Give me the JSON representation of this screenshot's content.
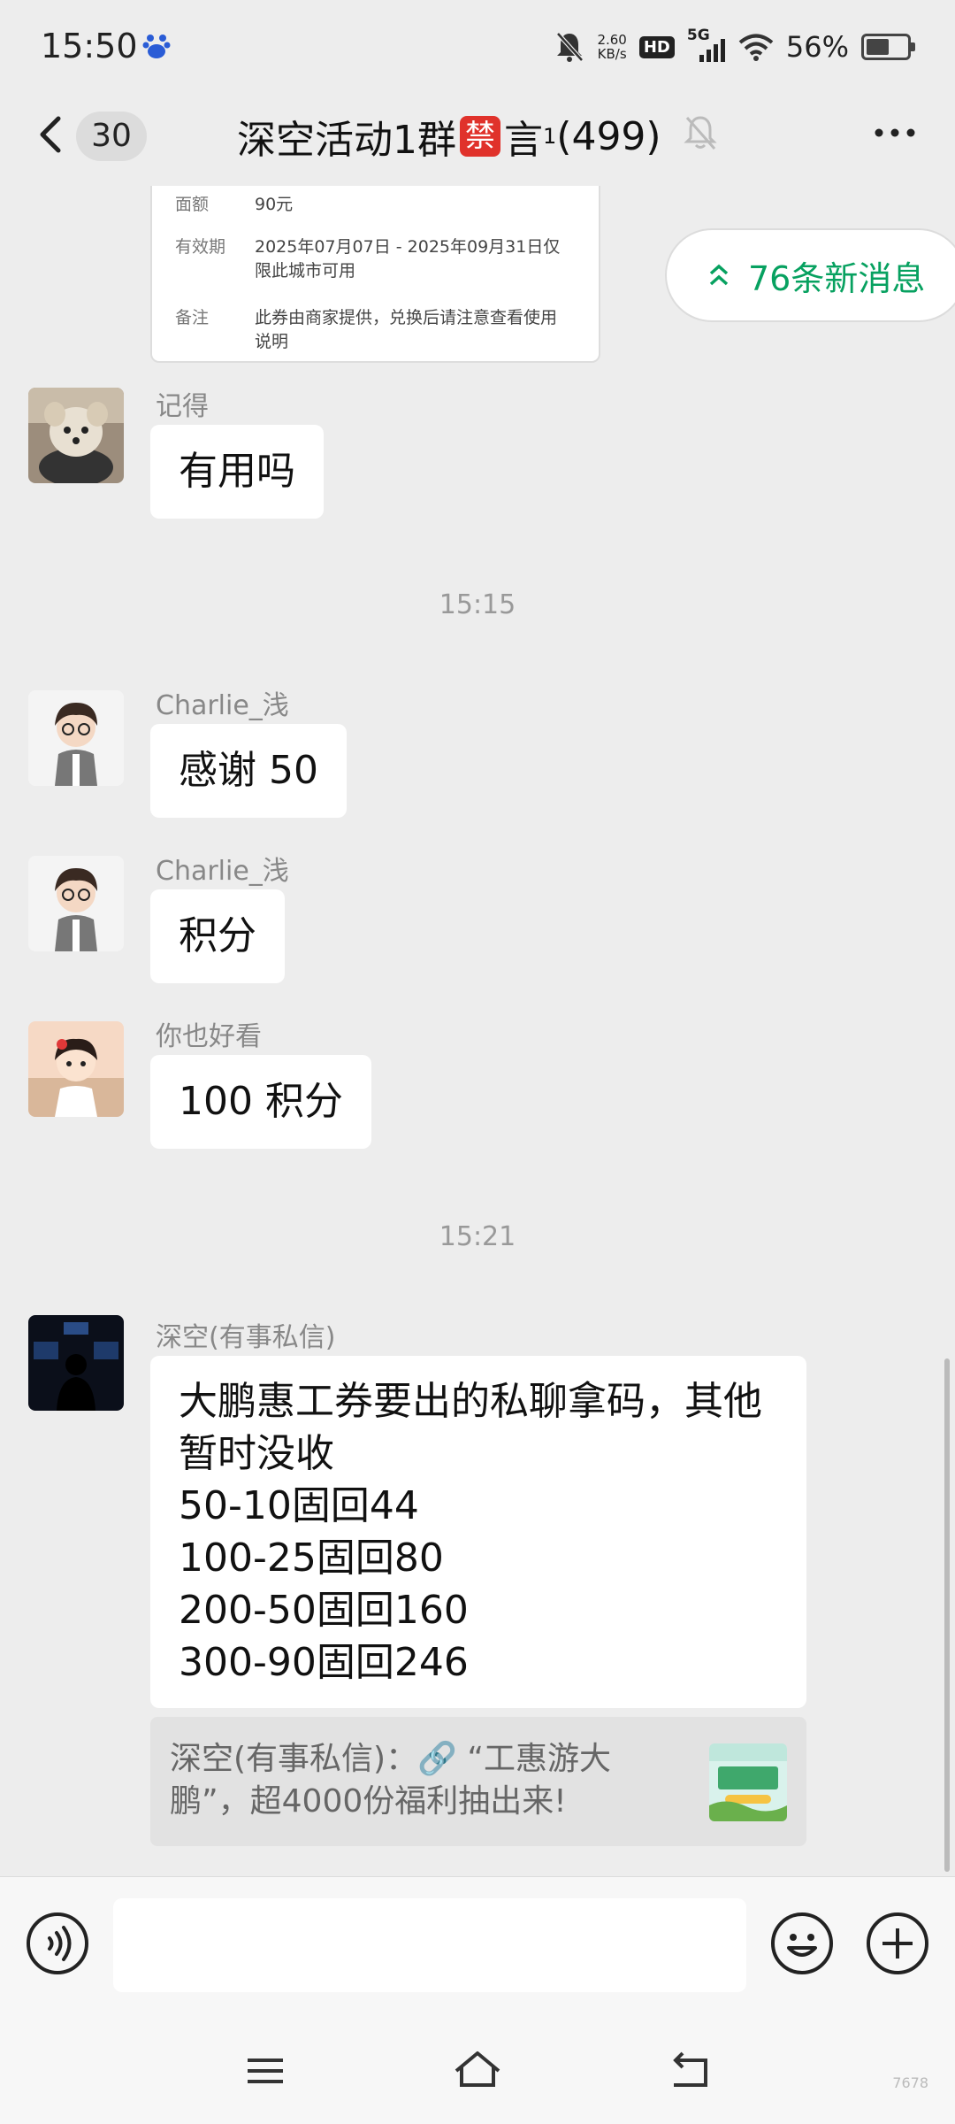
{
  "status": {
    "time": "15:50",
    "net_speed_value": "2.60",
    "net_speed_unit": "KB/s",
    "hd": "HD",
    "network": "5G",
    "battery": "56%",
    "battery_level": 0.56
  },
  "header": {
    "back_count": "30",
    "title_pre": "深空活动1群",
    "title_ban": "禁",
    "title_post": "言",
    "title_sup": "1",
    "member_count": "(499)"
  },
  "card": {
    "rows": [
      {
        "k": "面额",
        "v": "90元"
      },
      {
        "k": "有效期",
        "v": "2025年07月07日 - 2025年09月31日仅限此城市可用"
      },
      {
        "k": "备注",
        "v": "此券由商家提供，兑换后请注意查看使用说明"
      }
    ]
  },
  "new_messages": "76条新消息",
  "messages": [
    {
      "sender": "记得",
      "text": "有用吗"
    },
    {
      "sender": "Charlie_浅",
      "text": "感谢 50"
    },
    {
      "sender": "Charlie_浅",
      "text": "积分"
    },
    {
      "sender": "你也好看",
      "text": "100 积分"
    },
    {
      "sender": "深空(有事私信)",
      "lines": [
        "大鹏惠工券要出的私聊拿码，其他暂时没收",
        "50-10固回44",
        "100-25固回80",
        "200-50固回160",
        "300-90固回246"
      ]
    }
  ],
  "times": [
    "15:15",
    "15:21"
  ],
  "quote": {
    "text": "深空(有事私信)：🔗 “工惠游大鹏”，超4000份福利抽出来!"
  },
  "watermark": "7678"
}
